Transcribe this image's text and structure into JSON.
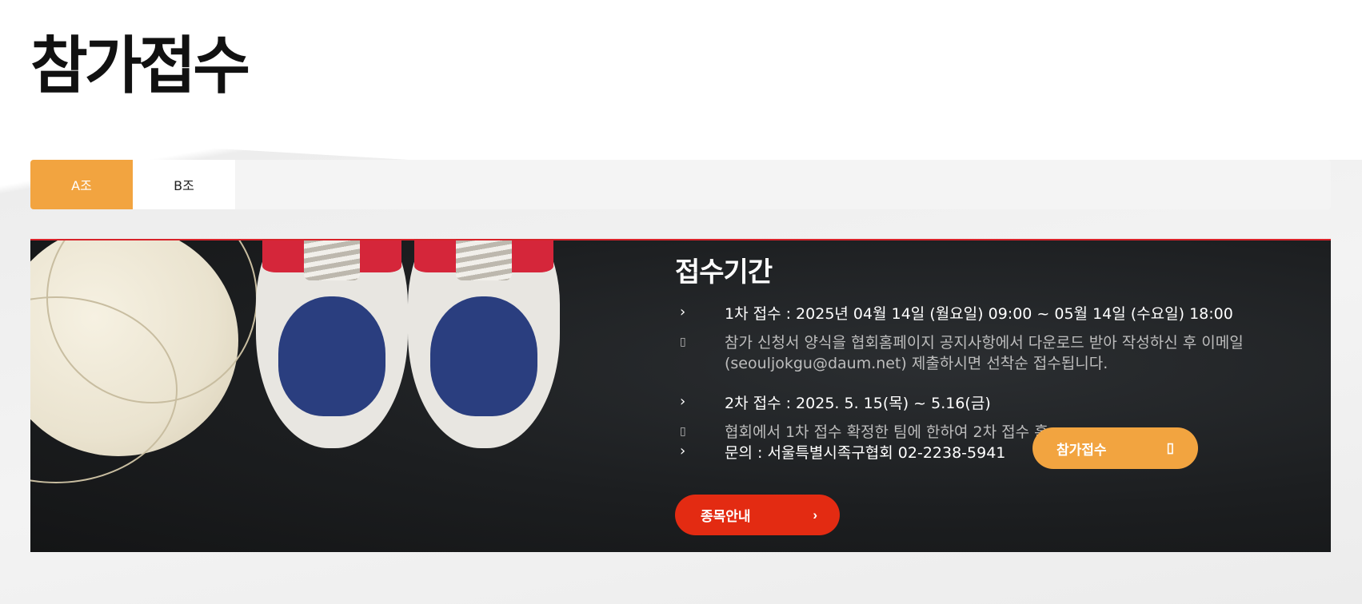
{
  "page": {
    "title": "참가접수"
  },
  "tabs": [
    {
      "label": "A조",
      "active": true
    },
    {
      "label": "B조",
      "active": false
    }
  ],
  "banner": {
    "heading": "접수기간",
    "first_round": "1차 접수 : 2025년 04월 14일 (월요일) 09:00 ~ 05월 14일 (수요일) 18:00",
    "first_note": "참가 신청서 양식을 협회홈페이지 공지사항에서 다운로드 받아 작성하신 후 이메일 (seouljokgu@daum.net) 제출하시면 선착순 접수됩니다.",
    "second_round": "2차 접수 : 2025. 5. 15(목) ~ 5.16(금)",
    "second_note": "협회에서 1차 접수 확정한 팀에 한하여 2차 접수 홈",
    "contact": "문의 : 서울특별시족구협회 02-2238-5941",
    "arrow_glyph": "›",
    "note_glyph": "▯"
  },
  "buttons": {
    "apply_label": "참가접수",
    "guide_label": "종목안내"
  },
  "colors": {
    "accent_orange": "#f2a440",
    "accent_red": "#e32b12",
    "banner_top_border": "#d8232a"
  }
}
